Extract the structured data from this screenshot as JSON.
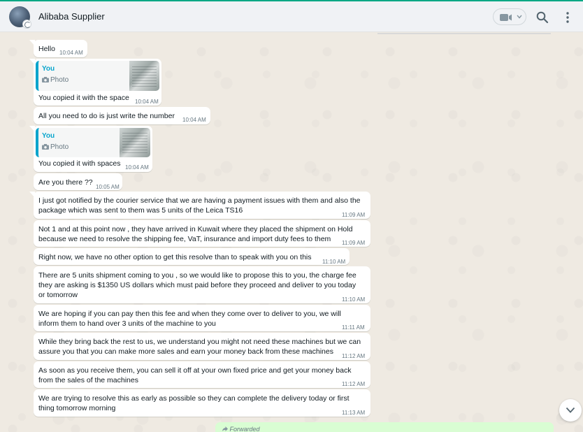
{
  "header": {
    "contact_name": "Alibaba Supplier",
    "icons": [
      "avatar",
      "video-call-icon",
      "chevron-down-icon",
      "search-icon",
      "menu-icon"
    ]
  },
  "colors": {
    "accent": "#00a884",
    "chat_bg": "#efeae2",
    "incoming_bubble": "#ffffff",
    "outgoing_bubble": "#d9fdd3",
    "quote_accent": "#06a4cc",
    "timestamp": "#667781"
  },
  "messages": [
    {
      "text": "Hello",
      "time": "10:04 AM"
    },
    {
      "quote": {
        "name": "You",
        "type": "Photo"
      },
      "text": "You copied it with the space",
      "time": "10:04 AM"
    },
    {
      "text": "All you need to do is just write the number",
      "time": "10:04 AM"
    },
    {
      "quote": {
        "name": "You",
        "type": "Photo"
      },
      "text": "You copied it with spaces",
      "time": "10:04 AM"
    },
    {
      "text": "Are you there ??",
      "time": "10:05 AM"
    },
    {
      "text": "I just got notified by the courier service that we are having a payment issues with them and also the\npackage which was sent to them was 5 units of the Leica TS16",
      "time": "11:09 AM"
    },
    {
      "text": "Not 1 and at this point now , they have arrived in Kuwait where they placed the shipment on Hold\nbecause we need to resolve the shipping fee, VaT, insurance and import duty fees to them",
      "time": "11:09 AM"
    },
    {
      "text": "Right now, we have no other option to get this resolve than to speak with you on this",
      "time": "11:10 AM"
    },
    {
      "text": "There are 5 units shipment coming to you , so we would like to propose this to you, the charge fee\nthey are asking is $1350 US dollars which must paid before they proceed and deliver to you today\nor tomorrow",
      "time": "11:10 AM"
    },
    {
      "text": "We are hoping if you can pay then this fee and when they come over to deliver to you, we will\ninform them to hand over 3 units of the machine to you",
      "time": "11:11 AM"
    },
    {
      "text": "While they bring back the rest to us, we understand you might not need these machines but we can\nassure you that you can make more sales and earn your money back from these machines",
      "time": "11:12 AM"
    },
    {
      "text": "As soon as you receive them, you can sell it off at your own fixed price and get your money back\nfrom the sales of the machines",
      "time": "11:12 AM"
    },
    {
      "text": "We are trying to resolve this as early as possible so they can complete the delivery today or first\nthing tomorrow morning",
      "time": "11:13 AM"
    }
  ],
  "outgoing_partial": {
    "label": "Forwarded"
  }
}
